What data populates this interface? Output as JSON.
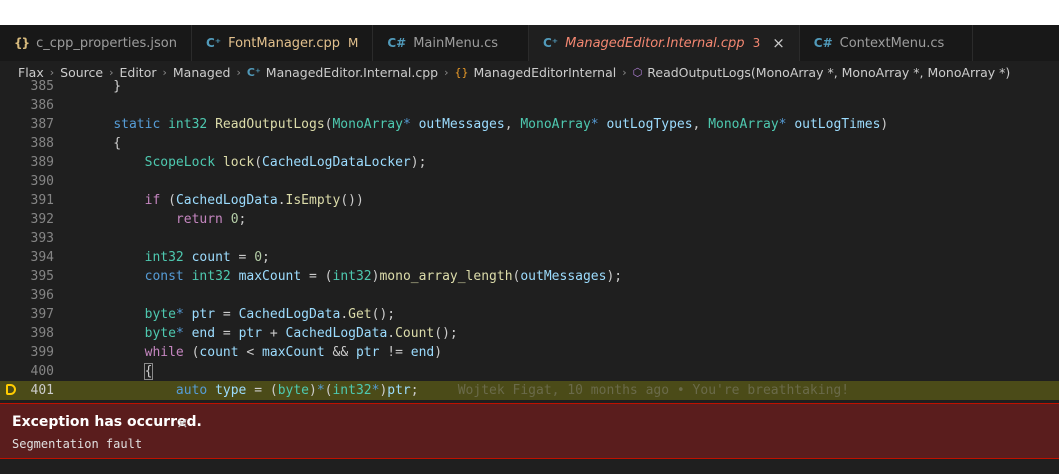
{
  "tabs": [
    {
      "icon": "{}",
      "label": "c_cpp_properties.json",
      "badge": "",
      "state": "normal"
    },
    {
      "icon": "C+",
      "label": "FontManager.cpp",
      "badge": "M",
      "state": "modified"
    },
    {
      "icon": "C#",
      "label": "MainMenu.cs",
      "badge": "",
      "state": "normal"
    },
    {
      "icon": "C+",
      "label": "ManagedEditor.Internal.cpp",
      "badge": "3",
      "state": "error-active",
      "close": "×"
    },
    {
      "icon": "C#",
      "label": "ContextMenu.cs",
      "badge": "",
      "state": "normal"
    }
  ],
  "breadcrumb": {
    "items": [
      "Flax",
      "Source",
      "Editor",
      "Managed",
      "ManagedEditor.Internal.cpp",
      "ManagedEditorInternal",
      "ReadOutputLogs(MonoArray *, MonoArray *, MonoArray *)"
    ],
    "separator": "›"
  },
  "editor": {
    "line_numbers": [
      "385",
      "386",
      "387",
      "388",
      "389",
      "390",
      "391",
      "392",
      "393",
      "394",
      "395",
      "396",
      "397",
      "398",
      "399",
      "400",
      "401"
    ],
    "current_line": "401",
    "blame": "Wojtek Figat, 10 months ago • You're breathtaking!"
  },
  "exception": {
    "title": "Exception has occurred.",
    "close": "×",
    "message": "Segmentation fault"
  },
  "colors": {
    "editor_bg": "#1f1f1f",
    "tabbar_bg": "#181818",
    "current_line_bg": "#4b4b18",
    "exception_bg": "#5a1d1d",
    "exception_border": "#be1100",
    "debug_arrow": "#ffcc00",
    "keyword": "#569cd6",
    "type": "#4ec9b0",
    "function": "#dcdcaa",
    "variable": "#9cdcfe",
    "number": "#b5cea8"
  }
}
